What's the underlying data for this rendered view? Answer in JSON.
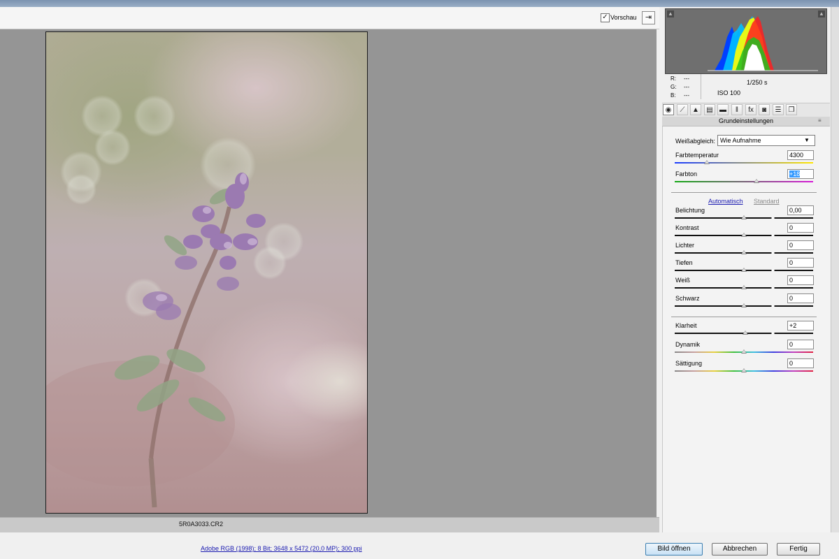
{
  "toolbar": {
    "preview_label": "Vorschau",
    "preview_checked": "✓",
    "fullscreen_glyph": "⇥"
  },
  "canvas": {
    "filename": "5R0A3033.CR2"
  },
  "histogram_readout": {
    "r_label": "R:",
    "r_value": "---",
    "g_label": "G:",
    "g_value": "---",
    "b_label": "B:",
    "b_value": "---",
    "shutter": "1/250 s",
    "iso": "ISO 100"
  },
  "tool_tabs": [
    {
      "icon": "basic-icon",
      "glyph": "◉"
    },
    {
      "icon": "tone-curve-icon",
      "glyph": "⟋"
    },
    {
      "icon": "detail-icon",
      "glyph": "▲"
    },
    {
      "icon": "hsl-icon",
      "glyph": "▤"
    },
    {
      "icon": "split-toning-icon",
      "glyph": "▬"
    },
    {
      "icon": "lens-corrections-icon",
      "glyph": "‖"
    },
    {
      "icon": "effects-icon",
      "glyph": "fx"
    },
    {
      "icon": "camera-calibration-icon",
      "glyph": "◙"
    },
    {
      "icon": "presets-icon",
      "glyph": "☰"
    },
    {
      "icon": "snapshots-icon",
      "glyph": "❐"
    }
  ],
  "panel": {
    "section_title": "Grundeinstellungen",
    "section_menu_glyph": "≡",
    "white_balance_label": "Weißabgleich:",
    "white_balance_value": "Wie Aufnahme",
    "auto_link": "Automatisch",
    "standard_link": "Standard",
    "sliders": [
      {
        "id": "temperature",
        "label": "Farbtemperatur",
        "value": "4300",
        "position": 0.23,
        "track": "temp"
      },
      {
        "id": "tint",
        "label": "Farbton",
        "value": "+18",
        "position": 0.59,
        "track": "tint"
      },
      {
        "id": "exposure",
        "label": "Belichtung",
        "value": "0,00",
        "position": 0.5,
        "track": "plain"
      },
      {
        "id": "contrast",
        "label": "Kontrast",
        "value": "0",
        "position": 0.5,
        "track": "plain"
      },
      {
        "id": "highlights",
        "label": "Lichter",
        "value": "0",
        "position": 0.5,
        "track": "plain"
      },
      {
        "id": "shadows",
        "label": "Tiefen",
        "value": "0",
        "position": 0.5,
        "track": "plain"
      },
      {
        "id": "whites",
        "label": "Weiß",
        "value": "0",
        "position": 0.5,
        "track": "plain"
      },
      {
        "id": "blacks",
        "label": "Schwarz",
        "value": "0",
        "position": 0.5,
        "track": "plain"
      },
      {
        "id": "clarity",
        "label": "Klarheit",
        "value": "+2",
        "position": 0.51,
        "track": "plain"
      },
      {
        "id": "vibrance",
        "label": "Dynamik",
        "value": "0",
        "position": 0.5,
        "track": "rainbow"
      },
      {
        "id": "saturation",
        "label": "Sättigung",
        "value": "0",
        "position": 0.5,
        "track": "rainbow"
      }
    ]
  },
  "bottom": {
    "workflow_options": "Adobe RGB (1998); 8 Bit; 3648 x 5472 (20,0 MP); 300 ppi",
    "open_button": "Bild öffnen",
    "cancel_button": "Abbrechen",
    "done_button": "Fertig"
  }
}
